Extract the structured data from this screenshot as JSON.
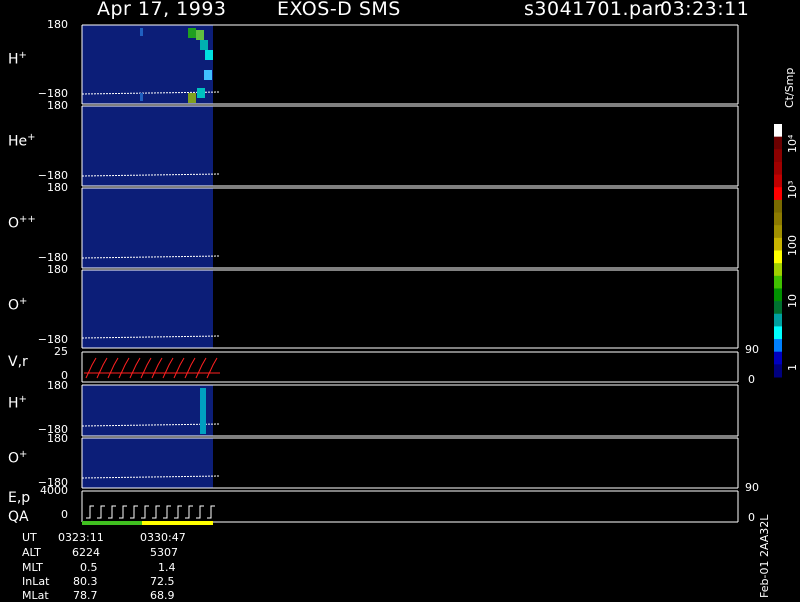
{
  "header": {
    "date": "Apr 17, 1993",
    "instrument": "EXOS-D SMS",
    "file": "s3041701.par",
    "time": "03:23:11"
  },
  "panels": [
    {
      "species": "H",
      "charge": "+",
      "ymax": "180",
      "ymin": "−180"
    },
    {
      "species": "He",
      "charge": "+",
      "ymax": "180",
      "ymin": "−180"
    },
    {
      "species": "O",
      "charge": "++",
      "ymax": "180",
      "ymin": "−180"
    },
    {
      "species": "O",
      "charge": "+",
      "ymax": "180",
      "ymin": "−180"
    },
    {
      "label": "V,r",
      "ymax": "25",
      "ymin": "0",
      "right_max": "90",
      "right_min": "0"
    },
    {
      "species": "H",
      "charge": "+",
      "ymax": "180",
      "ymin": "−180"
    },
    {
      "species": "O",
      "charge": "+",
      "ymax": "180",
      "ymin": "−180"
    },
    {
      "label": "E,p",
      "label2": "QA",
      "ymax": "4000",
      "ymin": "0",
      "right_max": "90",
      "right_min": "0"
    }
  ],
  "colorbar": {
    "unit": "Ct/Smp",
    "labels": [
      "10⁴",
      "10³",
      "100",
      "10",
      "1"
    ],
    "colors": [
      "#ffffff",
      "#6b0000",
      "#8c0000",
      "#a00000",
      "#c00000",
      "#ff0000",
      "#7a6a00",
      "#8c7a00",
      "#a09000",
      "#c8b400",
      "#ffff00",
      "#a0d000",
      "#40c000",
      "#009000",
      "#007030",
      "#00a0a0",
      "#00ffff",
      "#0080ff",
      "#0000c0",
      "#000080"
    ]
  },
  "ephemeris": {
    "rows": [
      {
        "name": "UT",
        "v1": "0323:11",
        "v2": "0330:47"
      },
      {
        "name": "ALT",
        "v1": "6224",
        "v2": "5307"
      },
      {
        "name": "MLT",
        "v1": "0.5",
        "v2": "1.4"
      },
      {
        "name": "InLat",
        "v1": "80.3",
        "v2": "72.5"
      },
      {
        "name": "MLat",
        "v1": "78.7",
        "v2": "68.9"
      }
    ]
  },
  "footer_vertical": "Feb-01 2AA32L",
  "chart_data": {
    "type": "heatmap",
    "title": "Apr 17, 1993   EXOS-D SMS",
    "x_range_ut": [
      "0323:11",
      "0330:47"
    ],
    "y_range_pitch_deg": [
      -180,
      180
    ],
    "panels": [
      "H+",
      "He+",
      "O++",
      "O+",
      "V,r",
      "H+",
      "O+",
      "E,p / QA"
    ],
    "colorbar_scale": "log",
    "colorbar_range_counts": [
      1,
      10000
    ]
  }
}
